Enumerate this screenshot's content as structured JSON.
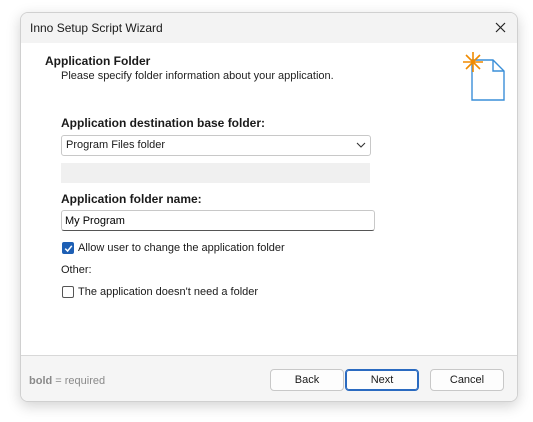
{
  "window": {
    "title": "Inno Setup Script Wizard"
  },
  "header": {
    "title": "Application Folder",
    "subtitle": "Please specify folder information about your application."
  },
  "form": {
    "base_folder_label": "Application destination base folder:",
    "base_folder_value": "Program Files folder",
    "folder_name_label": "Application folder name:",
    "folder_name_value": "My Program",
    "allow_change_label": "Allow user to change the application folder",
    "allow_change_checked": true,
    "other_label": "Other:",
    "no_folder_label": "The application doesn't need a folder",
    "no_folder_checked": false
  },
  "footer": {
    "hint_bold": "bold",
    "hint_rest": " = required",
    "back_label": "Back",
    "next_label": "Next",
    "cancel_label": "Cancel"
  },
  "colors": {
    "accent": "#1d5fb4",
    "star": "#f08a00",
    "page_icon": "#3a8fd8"
  },
  "icons": {
    "close": "close-icon",
    "header": "wizard-page-star-icon",
    "dropdown": "chevron-down-icon",
    "check": "checkmark-icon"
  }
}
